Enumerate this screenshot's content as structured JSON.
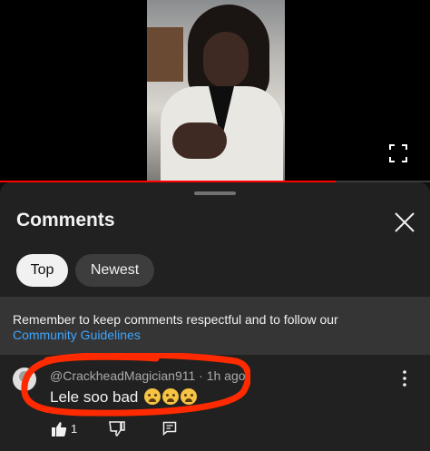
{
  "player": {
    "progress_fraction": 0.78,
    "progress_color": "#ff0000"
  },
  "comments_panel": {
    "title": "Comments",
    "filters": [
      {
        "label": "Top",
        "selected": true
      },
      {
        "label": "Newest",
        "selected": false
      }
    ],
    "notice": {
      "text": "Remember to keep comments respectful and to follow our",
      "link_text": "Community Guidelines",
      "link_color": "#3ea6ff"
    },
    "comments": [
      {
        "author": "@CrackheadMagician911",
        "separator": "·",
        "time": "1h ago",
        "text": "Lele soo bad",
        "emojis": [
          "weary-face",
          "weary-face",
          "woozy-face"
        ],
        "likes": "1"
      }
    ]
  },
  "annotation": {
    "color": "#ff2a00"
  }
}
